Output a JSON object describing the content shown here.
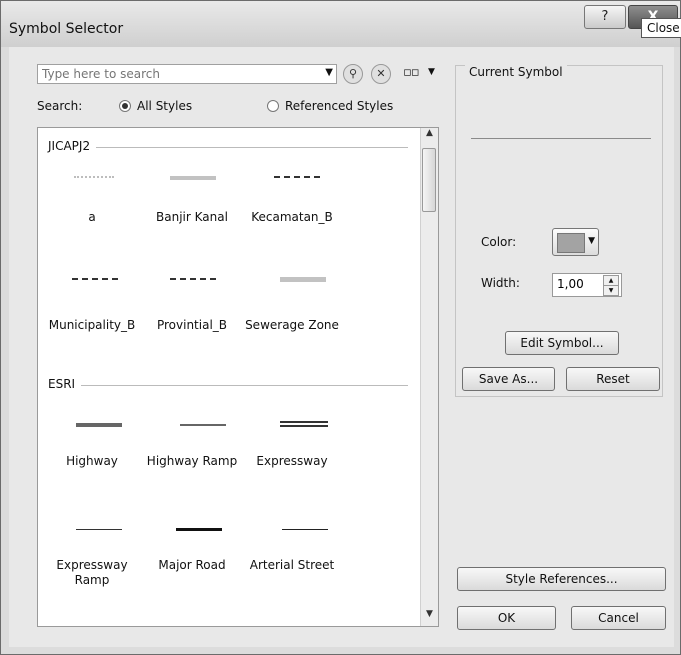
{
  "window": {
    "title": "Symbol Selector",
    "help_label": "?",
    "close_label": "X"
  },
  "search": {
    "placeholder": "Type here to search",
    "label": "Search:",
    "options": [
      "All Styles",
      "Referenced Styles"
    ],
    "selected": "All Styles"
  },
  "icons": {
    "search": "search-icon",
    "clear_search": "clear-search-icon",
    "view_options": "view-options-icon"
  },
  "groups": [
    {
      "name": "JICAPJ2",
      "symbols": [
        {
          "label": "a",
          "style": "dotted-light-gray"
        },
        {
          "label": "Banjir Kanal",
          "style": "thick-light-gray"
        },
        {
          "label": "Kecamatan_B",
          "style": "dash-dot-dark"
        },
        {
          "label": "Municipality_B",
          "style": "dash-dot-dark"
        },
        {
          "label": "Provintial_B",
          "style": "dash-dot-dark"
        },
        {
          "label": "Sewerage Zone",
          "style": "thick-light-gray"
        }
      ]
    },
    {
      "name": "ESRI",
      "symbols": [
        {
          "label": "Highway",
          "style": "thick-dark-gray"
        },
        {
          "label": "Highway Ramp",
          "style": "thin-gray"
        },
        {
          "label": "Expressway",
          "style": "double-line"
        },
        {
          "label": "Expressway Ramp",
          "style": "thin-dark"
        },
        {
          "label": "Major Road",
          "style": "medium-black"
        },
        {
          "label": "Arterial Street",
          "style": "thin-dark"
        }
      ]
    }
  ],
  "current_symbol": {
    "label": "Current Symbol",
    "color_label": "Color:",
    "color_value": "#a3a3a3",
    "width_label": "Width:",
    "width_value": "1,00"
  },
  "buttons": {
    "edit_symbol": "Edit Symbol...",
    "save_as": "Save As...",
    "reset": "Reset",
    "style_references": "Style References...",
    "ok": "OK",
    "cancel": "Cancel"
  },
  "tooltip": {
    "text": "Close"
  }
}
